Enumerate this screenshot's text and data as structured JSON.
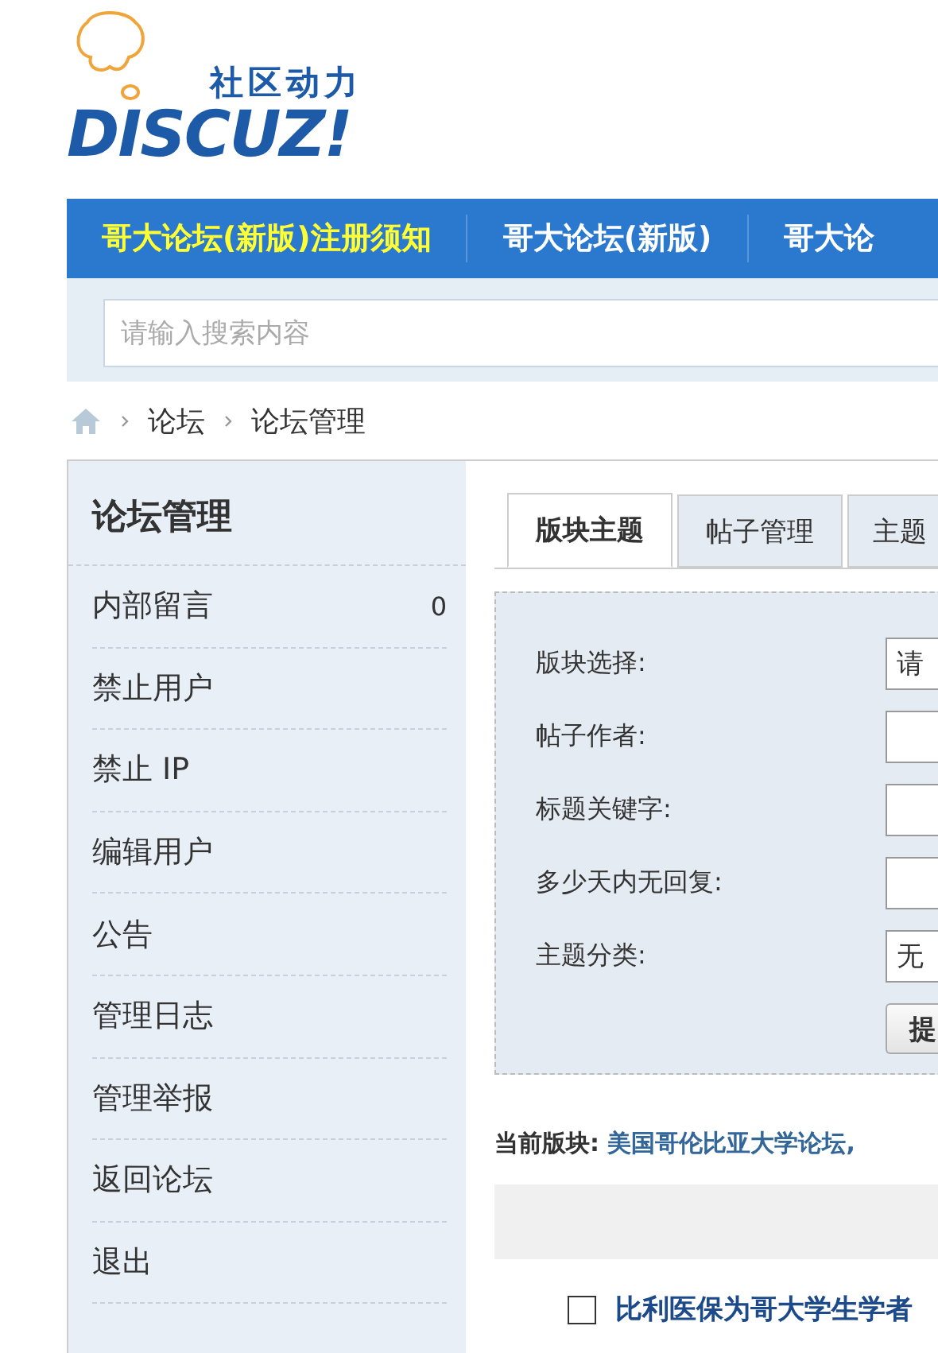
{
  "logo": {
    "tagline": "社区动力",
    "wordmark": "DISCUZ!"
  },
  "nav": [
    {
      "label": "哥大论坛(新版)注册须知",
      "highlighted": true
    },
    {
      "label": "哥大论坛(新版)",
      "highlighted": false
    },
    {
      "label": "哥大论",
      "highlighted": false
    }
  ],
  "search": {
    "placeholder": "请输入搜索内容"
  },
  "breadcrumb": [
    "论坛",
    "论坛管理"
  ],
  "sidebar": {
    "title": "论坛管理",
    "items": [
      {
        "label": "内部留言",
        "count": "0"
      },
      {
        "label": "禁止用户"
      },
      {
        "label": "禁止 IP"
      },
      {
        "label": "编辑用户"
      },
      {
        "label": "公告"
      },
      {
        "label": "管理日志"
      },
      {
        "label": "管理举报"
      },
      {
        "label": "返回论坛"
      },
      {
        "label": "退出"
      }
    ]
  },
  "tabs": [
    {
      "label": "版块主题",
      "selected": true
    },
    {
      "label": "帖子管理",
      "selected": false
    },
    {
      "label": "主题",
      "selected": false
    }
  ],
  "form": {
    "fields": [
      {
        "label": "版块选择:",
        "kind": "select",
        "value": "请"
      },
      {
        "label": "帖子作者:",
        "kind": "text"
      },
      {
        "label": "标题关键字:",
        "kind": "text"
      },
      {
        "label": "多少天内无回复:",
        "kind": "text"
      },
      {
        "label": "主题分类:",
        "kind": "select",
        "value": "无"
      }
    ],
    "submit": "提"
  },
  "current_board": {
    "label": "当前版块:",
    "value": "美国哥伦比亚大学论坛,"
  },
  "threads": [
    {
      "title": "比利医保为哥大学生学者",
      "checked": false
    }
  ]
}
